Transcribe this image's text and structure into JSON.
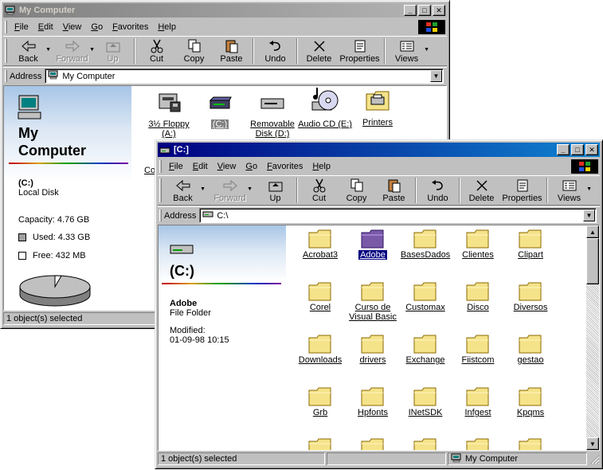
{
  "window_back": {
    "title": "My Computer",
    "menu": [
      "File",
      "Edit",
      "View",
      "Go",
      "Favorites",
      "Help"
    ],
    "toolbar": {
      "back": "Back",
      "forward": "Forward",
      "up": "Up",
      "cut": "Cut",
      "copy": "Copy",
      "paste": "Paste",
      "undo": "Undo",
      "delete": "Delete",
      "properties": "Properties",
      "views": "Views"
    },
    "address_label": "Address",
    "address_value": "My Computer",
    "panel": {
      "title_line1": "My",
      "title_line2": "Computer",
      "drive_label": "(C:)",
      "drive_type": "Local Disk",
      "capacity": "Capacity: 4.76 GB",
      "used": "Used: 4.33 GB",
      "free": "Free: 432 MB"
    },
    "icons": [
      {
        "label": "3½ Floppy (A:)"
      },
      {
        "label": "(C:)"
      },
      {
        "label": "Removable Disk (D:)"
      },
      {
        "label": "Audio CD (E:)"
      },
      {
        "label": "Printers"
      }
    ],
    "partial_label": "Cor",
    "status": "1 object(s) selected"
  },
  "window_front": {
    "title": "[C:]",
    "menu": [
      "File",
      "Edit",
      "View",
      "Go",
      "Favorites",
      "Help"
    ],
    "toolbar": {
      "back": "Back",
      "forward": "Forward",
      "up": "Up",
      "cut": "Cut",
      "copy": "Copy",
      "paste": "Paste",
      "undo": "Undo",
      "delete": "Delete",
      "properties": "Properties",
      "views": "Views"
    },
    "address_label": "Address",
    "address_value": "C:\\",
    "panel": {
      "title": "(C:)",
      "selected_name": "Adobe",
      "selected_type": "File Folder",
      "modified_label": "Modified:",
      "modified_value": "01-09-98 10:15"
    },
    "folders": [
      [
        "Acrobat3",
        "Adobe",
        "BasesDados",
        "Clientes",
        "Clipart"
      ],
      [
        "Corel",
        "Curso de Visual Basic",
        "Customax",
        "Disco",
        "Diversos"
      ],
      [
        "Downloads",
        "drivers",
        "Exchange",
        "Fiistcom",
        "gestao"
      ],
      [
        "Grb",
        "Hpfonts",
        "INetSDK",
        "Infgest",
        "Kpqms"
      ]
    ],
    "status_left": "1 object(s) selected",
    "status_right": "My Computer"
  },
  "colors": {
    "active_title": "#000080",
    "inactive_title": "#808080",
    "folder": "#f5e38a",
    "selection": "#000080",
    "pie_used": "#a0a0a0"
  }
}
